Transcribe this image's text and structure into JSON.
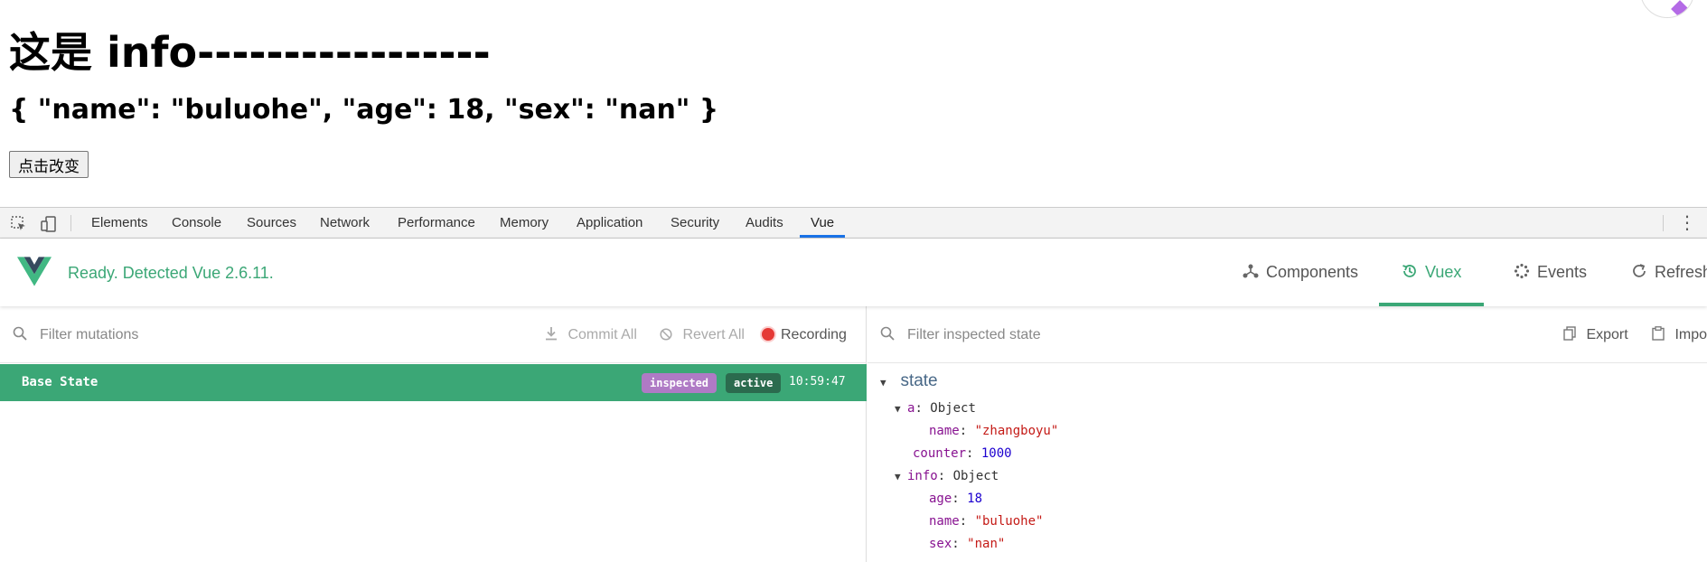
{
  "page": {
    "heading": "这是 info-----------------",
    "json_line": "{ \"name\": \"buluohe\", \"age\": 18, \"sex\": \"nan\" }",
    "button_label": "点击改变"
  },
  "devtools": {
    "tabs": [
      "Elements",
      "Console",
      "Sources",
      "Network",
      "Performance",
      "Memory",
      "Application",
      "Security",
      "Audits",
      "Vue"
    ],
    "active_tab": "Vue"
  },
  "vue": {
    "status": "Ready. Detected Vue 2.6.11.",
    "nav": [
      {
        "label": "Components",
        "icon": "components-icon"
      },
      {
        "label": "Vuex",
        "icon": "history-icon"
      },
      {
        "label": "Events",
        "icon": "events-icon"
      },
      {
        "label": "Refresh",
        "icon": "refresh-icon"
      }
    ],
    "brand_color": "#3ba776"
  },
  "mutations": {
    "filter_placeholder": "Filter mutations",
    "commit_all": "Commit All",
    "revert_all": "Revert All",
    "recording": "Recording",
    "rows": [
      {
        "name": "Base State",
        "badges": [
          "inspected",
          "active"
        ],
        "time": "10:59:47"
      }
    ]
  },
  "inspector": {
    "filter_placeholder": "Filter inspected state",
    "export": "Export",
    "import": "Import",
    "section": "state",
    "tree": {
      "a_key": "a",
      "a_type": "Object",
      "a_name_key": "name",
      "a_name_val": "\"zhangboyu\"",
      "counter_key": "counter",
      "counter_val": "1000",
      "info_key": "info",
      "info_type": "Object",
      "age_key": "age",
      "age_val": "18",
      "name_key": "name",
      "name_val": "\"buluohe\"",
      "sex_key": "sex",
      "sex_val": "\"nan\""
    }
  }
}
